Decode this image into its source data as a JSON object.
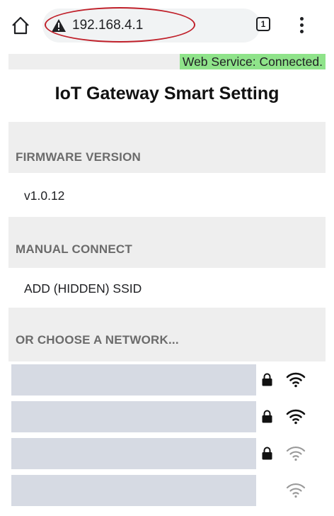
{
  "browser": {
    "url": "192.168.4.1",
    "tab_count": "1"
  },
  "status": {
    "text": "Web Service: Connected."
  },
  "page": {
    "title": "IoT Gateway Smart Setting"
  },
  "firmware": {
    "header": "FIRMWARE VERSION",
    "value": "v1.0.12"
  },
  "manual": {
    "header": "MANUAL CONNECT",
    "add_label": "ADD (HIDDEN) SSID"
  },
  "networks": {
    "header": "OR CHOOSE A NETWORK...",
    "items": [
      {
        "secured": true,
        "signal": "strong"
      },
      {
        "secured": true,
        "signal": "strong"
      },
      {
        "secured": true,
        "signal": "weak"
      },
      {
        "secured": false,
        "signal": "weak"
      }
    ]
  },
  "colors": {
    "status_bg": "#8fe38a",
    "highlight_ring": "#c0202a",
    "section_bg": "#eeeeee",
    "redaction": "#d6dae3"
  },
  "icons": [
    "home-icon",
    "warning-icon",
    "tabs-icon",
    "more-vert-icon",
    "lock-icon",
    "wifi-icon"
  ]
}
